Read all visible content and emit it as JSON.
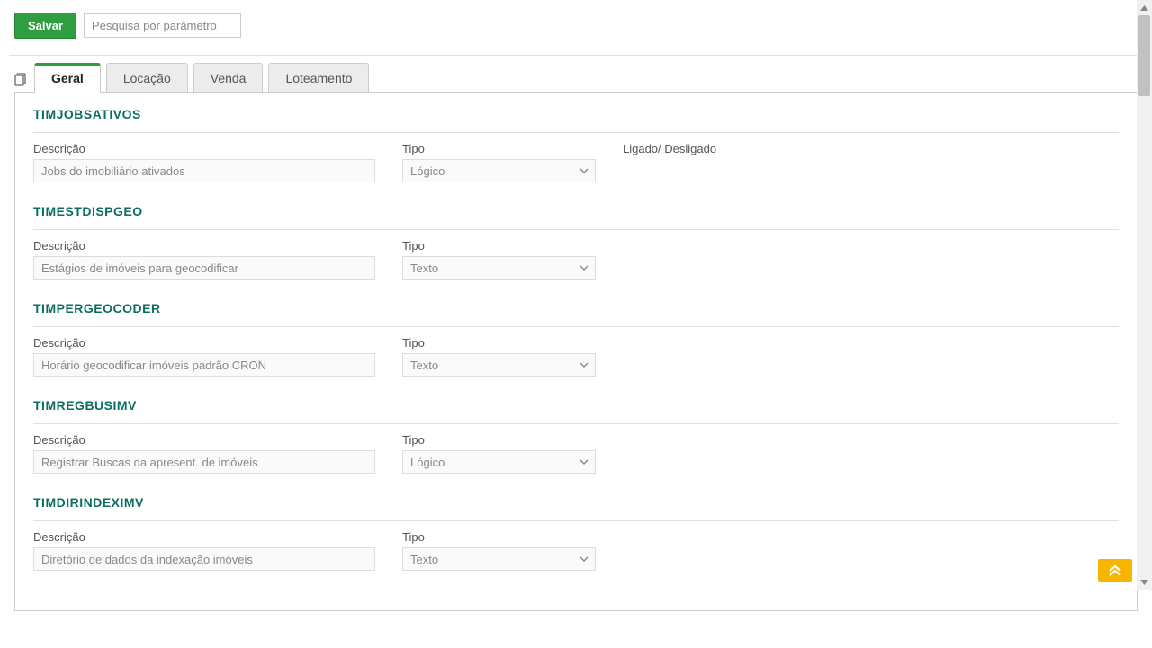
{
  "toolbar": {
    "save_label": "Salvar",
    "search_placeholder": "Pesquisa por parâmetro"
  },
  "tabs": [
    {
      "label": "Geral",
      "active": true
    },
    {
      "label": "Locação",
      "active": false
    },
    {
      "label": "Venda",
      "active": false
    },
    {
      "label": "Loteamento",
      "active": false
    }
  ],
  "labels": {
    "descricao": "Descrição",
    "tipo": "Tipo",
    "ligado": "Ligado/ Desligado"
  },
  "sections": [
    {
      "code": "TIMJOBSATIVOS",
      "descricao": "Jobs do imobiliário ativados",
      "tipo": "Lógico",
      "show_ligado": true
    },
    {
      "code": "TIMESTDISPGEO",
      "descricao": "Estágios de imóveis para geocodificar",
      "tipo": "Texto",
      "show_ligado": false
    },
    {
      "code": "TIMPERGEOCODER",
      "descricao": "Horário geocodificar imóveis padrão CRON",
      "tipo": "Texto",
      "show_ligado": false
    },
    {
      "code": "TIMREGBUSIMV",
      "descricao": "Registrar Buscas da apresent. de imóveis",
      "tipo": "Lógico",
      "show_ligado": false
    },
    {
      "code": "TIMDIRINDEXIMV",
      "descricao": "Diretório de dados da indexação imóveis",
      "tipo": "Texto",
      "show_ligado": false
    }
  ]
}
